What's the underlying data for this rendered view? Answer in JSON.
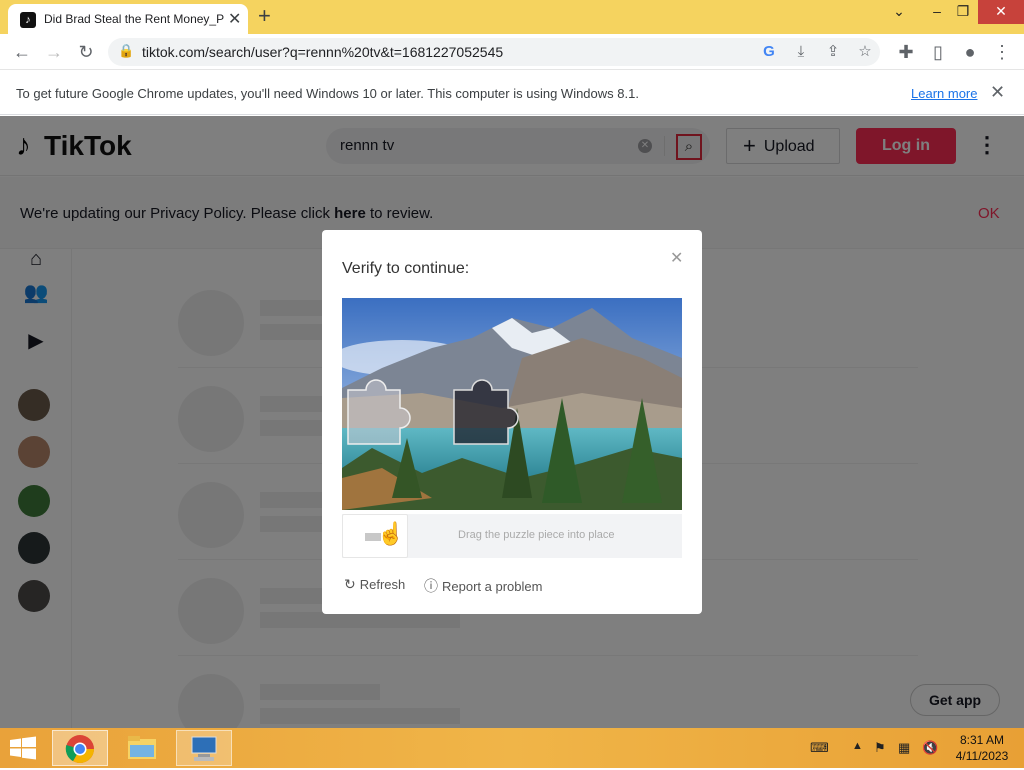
{
  "browser": {
    "tab_title": "Did Brad Steal the Rent Money_P",
    "tab_favicon": "tiktok-icon",
    "url": "tiktok.com/search/user?q=rennn%20tv&t=1681227052545",
    "infobar_message": "To get future Google Chrome updates, you'll need Windows 10 or later. This computer is using Windows 8.1.",
    "infobar_link": "Learn more"
  },
  "tiktok": {
    "logo_text": "TikTok",
    "search_value": "rennn tv",
    "upload_label": "Upload",
    "login_label": "Log in",
    "privacy_text_before": "We're updating our Privacy Policy. Please click ",
    "privacy_link": "here",
    "privacy_text_after": " to review.",
    "privacy_ok": "OK",
    "get_app": "Get app"
  },
  "captcha": {
    "title": "Verify to continue:",
    "slider_hint": "Drag the puzzle piece into place",
    "refresh_label": "Refresh",
    "report_label": "Report a problem"
  },
  "taskbar": {
    "time": "8:31 AM",
    "date": "4/11/2023"
  },
  "colors": {
    "tiktok_accent": "#fe2c55",
    "chrome_tabbar": "#f5d35f",
    "taskbar": "#f0b548"
  }
}
